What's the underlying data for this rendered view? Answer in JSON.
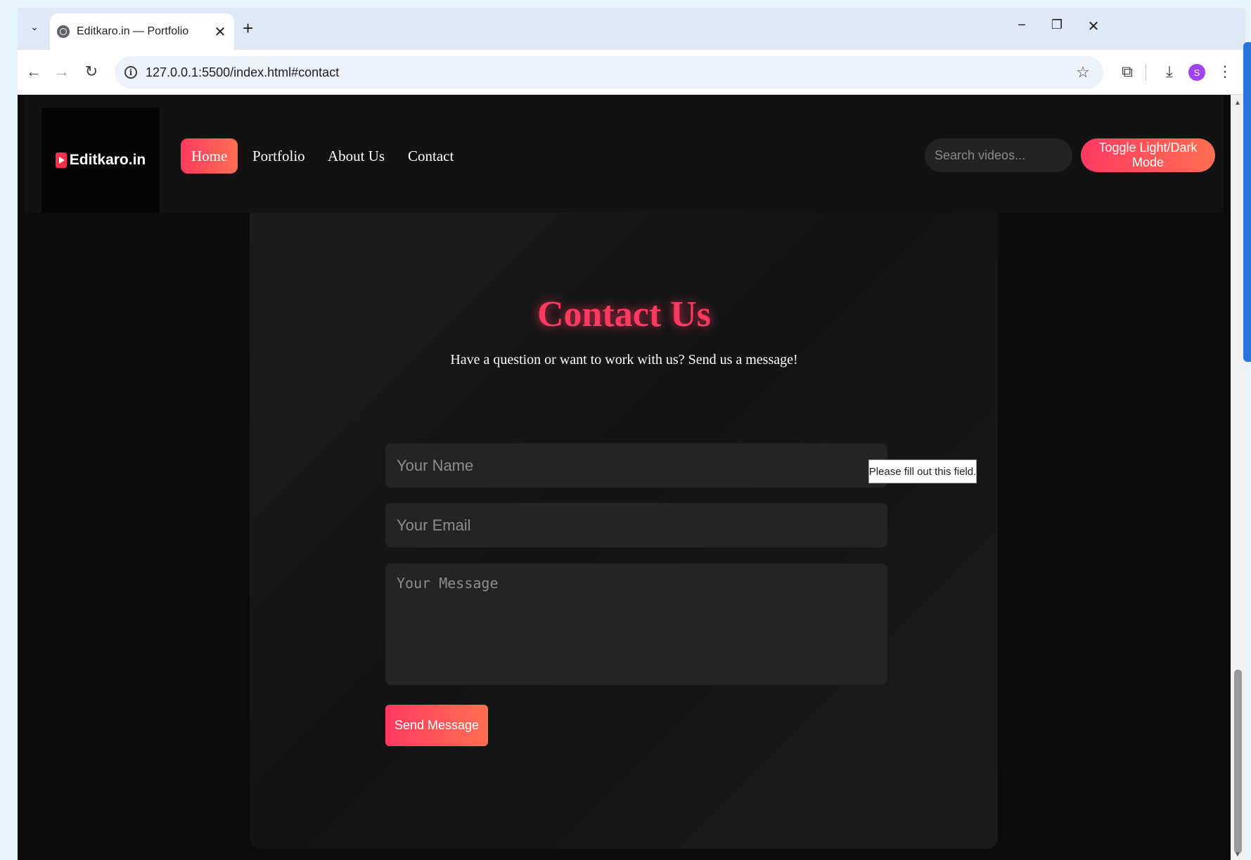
{
  "browser": {
    "tab_title": "Editkaro.in — Portfolio",
    "new_tab_symbol": "+",
    "close_symbol": "✕",
    "tab_search_symbol": "⌄",
    "window_controls": {
      "minimize": "−",
      "restore": "❐",
      "close": "✕"
    },
    "nav": {
      "back": "←",
      "forward": "→",
      "reload": "↻"
    },
    "url": "127.0.0.1:5500/index.html#contact",
    "info_symbol": "i",
    "bookmark_symbol": "☆",
    "extensions_symbol": "⧉",
    "download_symbol": "⤓",
    "profile_initial": "S",
    "menu_symbol": "⋮"
  },
  "site": {
    "logo_text": "Editkaro.in",
    "nav_items": [
      "Home",
      "Portfolio",
      "About Us",
      "Contact"
    ],
    "active_nav": "Home",
    "search_placeholder": "Search videos...",
    "toggle_label": "Toggle Light/Dark Mode"
  },
  "contact": {
    "title": "Contact Us",
    "subtitle": "Have a question or want to work with us? Send us a message!",
    "name_placeholder": "Your Name",
    "email_placeholder": "Your Email",
    "message_placeholder": "Your Message",
    "send_label": "Send Message",
    "validation_tooltip": "Please fill out this field."
  },
  "colors": {
    "accent": "#ff3a61",
    "accent_2": "#ff6f52",
    "page_bg": "#0b0b0b",
    "card_bg": "#181818",
    "field_bg": "#242424"
  }
}
